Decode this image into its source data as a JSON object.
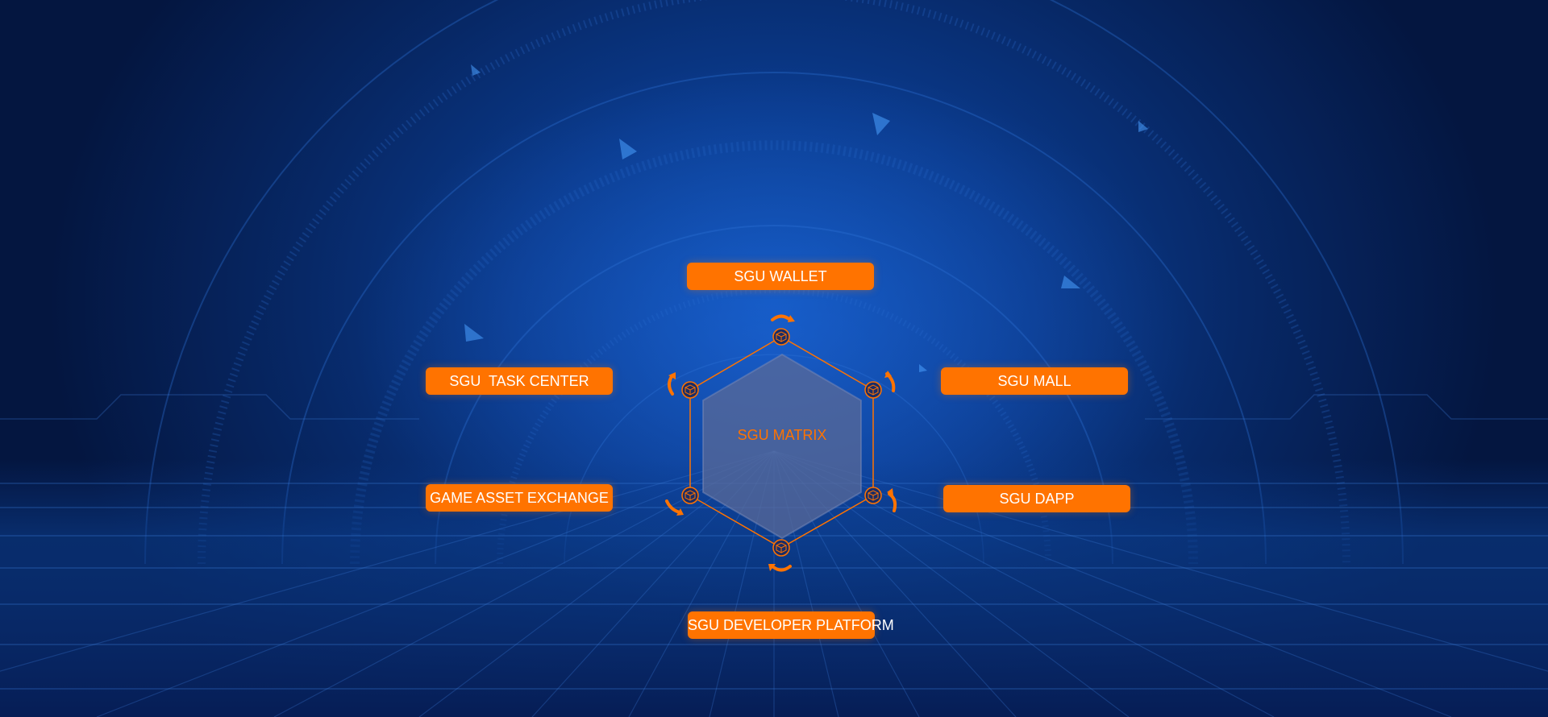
{
  "colors": {
    "accent": "#ff7300",
    "background_dark": "#041640",
    "background_light": "#0e4fb0",
    "hexagon_fill": "#5a6a98"
  },
  "center": {
    "label": "SGU MATRIX"
  },
  "nodes": {
    "wallet": "SGU WALLET",
    "task_center": "SGU  TASK CENTER",
    "mall": "SGU MALL",
    "game_asset_exchange": "GAME ASSET EXCHANGE",
    "dapp": "SGU DAPP",
    "developer_platform": "SGU DEVELOPER PLATFORM"
  },
  "icons": {
    "node_icon": "cube-icon",
    "rotate_icon": "rotate-arrow-icon"
  }
}
